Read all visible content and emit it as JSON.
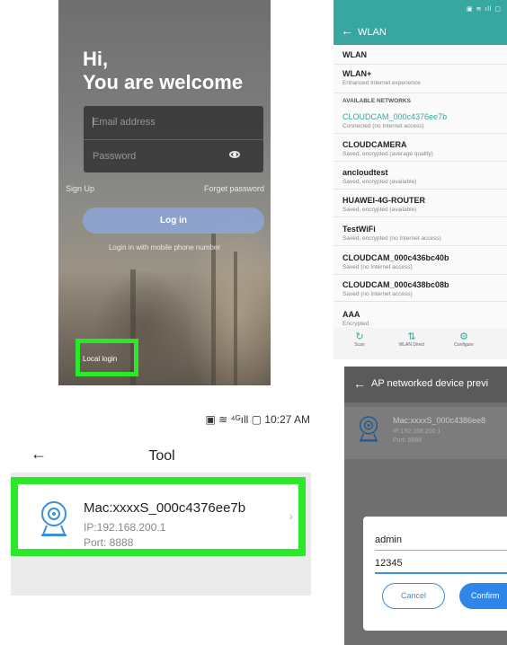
{
  "login": {
    "greeting_line1": "Hi,",
    "greeting_line2": "You are welcome",
    "email_placeholder": "Email address",
    "password_placeholder": "Password",
    "sign_up": "Sign Up",
    "forget_password": "Forget password",
    "login_button": "Log in",
    "phone_login": "Login in with mobile phone number",
    "local_login": "Local login",
    "highlight_color": "#2ce82a"
  },
  "wlan": {
    "status_icons": "▣ ≋ ıll ▢",
    "title": "WLAN",
    "wlan_label": "WLAN",
    "wlan_plus_label": "WLAN+",
    "wlan_plus_sub": "Enhanced Internet experience",
    "section_header": "AVAILABLE NETWORKS",
    "networks": [
      {
        "ssid": "CLOUDCAM_000c4376ee7b",
        "status": "Connected (no Internet access)"
      },
      {
        "ssid": "CLOUDCAMERA",
        "status": "Saved, encrypted (average quality)"
      },
      {
        "ssid": "ancloudtest",
        "status": "Saved, encrypted (available)"
      },
      {
        "ssid": "HUAWEI-4G-ROUTER",
        "status": "Saved, encrypted (available)"
      },
      {
        "ssid": "TestWiFi",
        "status": "Saved, encrypted (no Internet access)"
      },
      {
        "ssid": "CLOUDCAM_000c436bc40b",
        "status": "Saved (no Internet access)"
      },
      {
        "ssid": "CLOUDCAM_000c438bc08b",
        "status": "Saved (no Internet access)"
      },
      {
        "ssid": "AAA",
        "status": "Encrypted"
      }
    ],
    "bottom_bar": [
      {
        "label": "Scan",
        "icon": "refresh-icon"
      },
      {
        "label": "WLAN Direct",
        "icon": "wifi-direct-icon"
      },
      {
        "label": "Configure",
        "icon": "gear-icon"
      }
    ],
    "accent_color": "#39a7a1"
  },
  "tool": {
    "status_bar": "▣ ≋ ⁴ᴳıll ▢ 10:27 AM",
    "title": "Tool",
    "device": {
      "mac": "Mac:xxxxS_000c4376ee7b",
      "ip": "IP:192.168.200.1",
      "port": "Port: 8888"
    }
  },
  "ap": {
    "title": "AP networked device previ",
    "device": {
      "mac": "Mac:xxxxS_000c4386ee8",
      "ip": "IP:192.168.200.1",
      "port": "Port: 8888"
    },
    "dialog": {
      "username_value": "admin",
      "password_value": "12345",
      "cancel_label": "Cancel",
      "confirm_label": "Confirm"
    }
  }
}
